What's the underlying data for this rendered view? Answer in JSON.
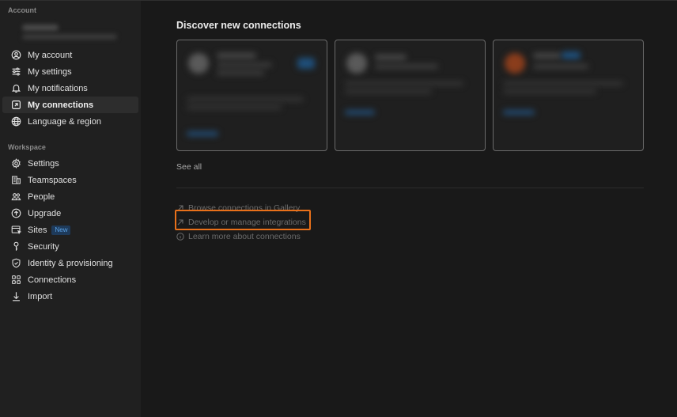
{
  "sidebar": {
    "account_label": "Account",
    "account_items": [
      {
        "label": "My account",
        "icon": "user-circle-icon"
      },
      {
        "label": "My settings",
        "icon": "sliders-icon"
      },
      {
        "label": "My notifications",
        "icon": "bell-icon"
      },
      {
        "label": "My connections",
        "icon": "arrow-box-icon",
        "active": true
      },
      {
        "label": "Language & region",
        "icon": "globe-icon"
      }
    ],
    "workspace_label": "Workspace",
    "workspace_items": [
      {
        "label": "Settings",
        "icon": "gear-icon"
      },
      {
        "label": "Teamspaces",
        "icon": "building-icon"
      },
      {
        "label": "People",
        "icon": "people-icon"
      },
      {
        "label": "Upgrade",
        "icon": "upgrade-icon"
      },
      {
        "label": "Sites",
        "icon": "sites-icon",
        "badge": "New"
      },
      {
        "label": "Security",
        "icon": "key-icon"
      },
      {
        "label": "Identity & provisioning",
        "icon": "shield-icon"
      },
      {
        "label": "Connections",
        "icon": "grid-icon"
      },
      {
        "label": "Import",
        "icon": "download-icon"
      }
    ]
  },
  "main": {
    "title": "Discover new connections",
    "see_all": "See all",
    "links": [
      {
        "label": "Browse connections in Gallery",
        "icon": "external-arrow-icon"
      },
      {
        "label": "Develop or manage integrations",
        "icon": "external-arrow-icon"
      },
      {
        "label": "Learn more about connections",
        "icon": "info-icon"
      }
    ]
  },
  "colors": {
    "highlight": "#e8701a",
    "badge_text": "#5aa3e8",
    "badge_bg": "#1e3a5a"
  }
}
